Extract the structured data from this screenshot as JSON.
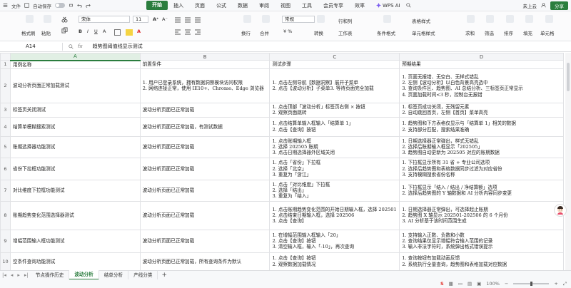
{
  "titlebar": {
    "file_label": "文件",
    "autosave_label": "自动保存",
    "tabs": [
      "开始",
      "插入",
      "页面",
      "公式",
      "数据",
      "审阅",
      "视图",
      "工具",
      "会员专享",
      "效率"
    ],
    "active_tab": "开始",
    "wps_ai_label": "WPS AI",
    "cloud_label": "未上云",
    "share_label": "分享"
  },
  "ribbon": {
    "format_painter": "格式刷",
    "paste": "粘贴",
    "font_name": "宋体",
    "font_size": "11",
    "wrap": "换行",
    "merge": "合并",
    "number_format": "常规",
    "convert": "转换",
    "row_col": "行和列",
    "worksheet": "工作表",
    "cond_format": "条件格式",
    "table_style": "表格样式",
    "cell_style": "单元格样式",
    "sum": "求和",
    "filter": "筛选",
    "sort": "排序",
    "fill": "填充",
    "cell": "单元格"
  },
  "formula_bar": {
    "cell_ref": "A14",
    "content": "趋势图阈值线显示测试"
  },
  "columns": [
    "A",
    "B",
    "C",
    "D"
  ],
  "rows": [
    {
      "num": "1",
      "a": "用例名称",
      "b": "前置条件",
      "c": "测试步骤",
      "d": "预期结果"
    },
    {
      "num": "2",
      "a": "波动分析页面正常加载测试",
      "b": "1. 用户已登录系统，拥有数据洞察模块访问权限\n2. 网络连接正常，使用 IE10+、Chrome、Edge 浏览器",
      "c": "1. 点击左侧导航【数据洞察】展开子菜单\n2. 点击【波动分析】子菜单3. 等待页面完全加载",
      "d": "1. 页面无报错、无空白、无样式错乱\n2. 左侧【波动分析】以白色背景高亮选中\n3. 查询条件区、趋势图、AI 总结分析、三标签页正常显示\n4. 页面加载时间<3 秒，控制台无报错"
    },
    {
      "num": "3",
      "a": "标签页关闭测试",
      "b": "波动分析页面已正常加载",
      "c": "1. 点击顶部「波动分析」标签页右侧 × 按钮\n2. 观察页面跳转",
      "d": "1. 标签页成功关闭，无残留元素\n2. 自动跳回首页，左侧【首页】菜单高亮"
    },
    {
      "num": "4",
      "a": "结算单模糊搜索测试",
      "b": "波动分析页面已正常加载，有测试数据",
      "c": "1. 点击结算单输入框输入「结算单 1」\n2. 点击【查询】按钮",
      "d": "1. 趋势图和下方表格仅显示与「结算单 1」相关的数据\n2. 支持部分匹配，搜索结果准确"
    },
    {
      "num": "5",
      "a": "账期选择器功能测试",
      "b": "波动分析页面已正常加载",
      "c": "1. 点击账期输入框\n2. 选择 202505 账期\n3. 点击日期选择器外区域关闭",
      "d": "1. 日期选择器正常弹出，样式无错乱\n2. 选择后账期输入框显示「202505」\n3. 趋势图自动更新为 202505 对应的账期数据"
    },
    {
      "num": "6",
      "a": "省份下拉框功能测试",
      "b": "波动分析页面已正常加载",
      "c": "1. 点击「省份」下拉框\n2. 选择「北京」\n3. 重复为「浙江」",
      "d": "1. 下拉框显示所有 31 省 + 专业公司选项\n2. 选择后趋势图和表格数据同步过滤为对应省份\n3. 支持模糊搜索省份名称"
    },
    {
      "num": "7",
      "a": "对比维度下拉框功能测试",
      "b": "波动分析页面已正常加载",
      "c": "1. 点击「对比维度」下拉框\n2. 选择「结出」\n3. 重复为「结入」",
      "d": "1. 下拉框显示「结入 / 结出 / 净结算额」选项\n2. 选择后趋势图的 Y 轴数据和 AI 分析内容同步变更"
    },
    {
      "num": "8",
      "a": "账期趋势变化范围选择器测试",
      "b": "波动分析页面已正常加载",
      "c": "1. 点击账期趋势变化范围的开始日期输入框，选择 202501\n2. 点击结束日期输入框，选择 202506\n3. 点击【查询】",
      "d": "1. 日期选择器正常弹出，可选择起止账期\n2. 趋势图 X 轴显示 202501-202506 的 6 个月份\n3. AI 分析基于该时间范围生成"
    },
    {
      "num": "9",
      "a": "增幅范围输入框功能测试",
      "b": "波动分析页面已正常加载",
      "c": "1. 在增幅范围输入框输入「20」\n2. 点击【查询】按钮\n3. 清空输入框，输入「-10」，再次查询",
      "d": "1. 支持输入正数、负数和小数\n2. 查询结果仅显示增幅符合输入范围的记录\n3. 输入非法字符时，系统弹出格式错误提示"
    },
    {
      "num": "10",
      "a": "空条件查询功能测试",
      "b": "波动分析页面已正常加载，所有查询条件为默认",
      "c": "1. 点击【查询】按钮\n2. 观察数据加载情况",
      "d": "1. 查询按钮有加载动画反馈\n2. 系统执行全量查询，趋势图和表格加载对应数据"
    }
  ],
  "sheets": [
    "节点操作历史",
    "波动分析",
    "结单分析",
    "产线分类"
  ],
  "active_sheet": "波动分析",
  "status": {
    "zoom": "100%"
  }
}
